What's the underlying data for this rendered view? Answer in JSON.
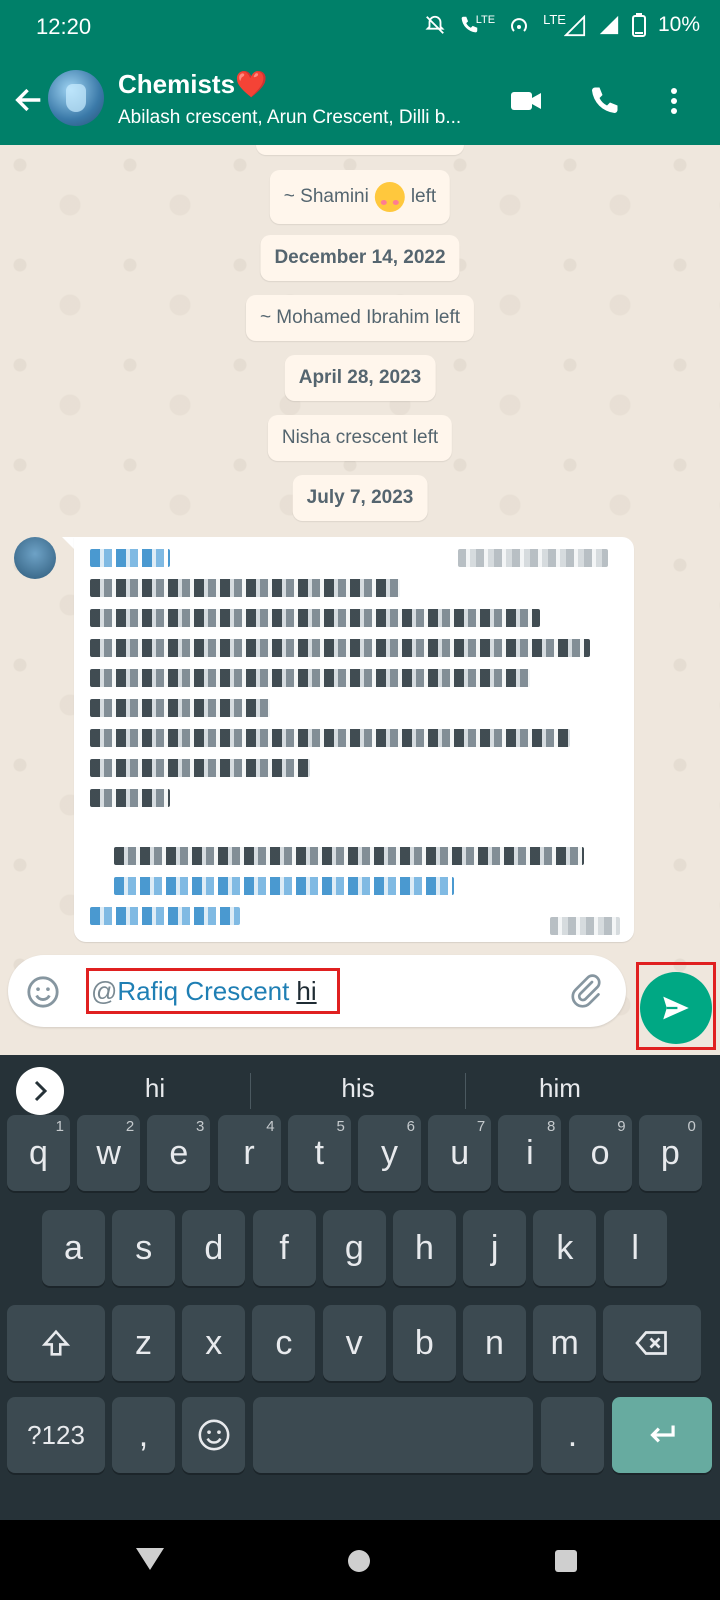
{
  "status_bar": {
    "time": "12:20",
    "lte1": "LTE",
    "lte2": "LTE",
    "battery": "10%"
  },
  "header": {
    "title": "Chemists❤️",
    "subtitle": "Abilash crescent, Arun Crescent, Dilli b..."
  },
  "messages": {
    "system": [
      {
        "text": "~ Shamini",
        "suffix": "left",
        "has_emoji": true
      },
      {
        "text": "December 14, 2022",
        "is_date": true
      },
      {
        "text": "~ Mohamed Ibrahim left"
      },
      {
        "text": "April 28, 2023",
        "is_date": true
      },
      {
        "text": "Nisha crescent left"
      },
      {
        "text": "July 7, 2023",
        "is_date": true
      }
    ]
  },
  "composer": {
    "mention_at": "@",
    "mention_name": "Rafiq Crescent",
    "typed": "hi"
  },
  "keyboard": {
    "suggestions": [
      "hi",
      "his",
      "him"
    ],
    "row1": [
      {
        "k": "q",
        "h": "1"
      },
      {
        "k": "w",
        "h": "2"
      },
      {
        "k": "e",
        "h": "3"
      },
      {
        "k": "r",
        "h": "4"
      },
      {
        "k": "t",
        "h": "5"
      },
      {
        "k": "y",
        "h": "6"
      },
      {
        "k": "u",
        "h": "7"
      },
      {
        "k": "i",
        "h": "8"
      },
      {
        "k": "o",
        "h": "9"
      },
      {
        "k": "p",
        "h": "0"
      }
    ],
    "row2": [
      "a",
      "s",
      "d",
      "f",
      "g",
      "h",
      "j",
      "k",
      "l"
    ],
    "row3": [
      "z",
      "x",
      "c",
      "v",
      "b",
      "n",
      "m"
    ],
    "symbols_label": "?123",
    "comma": ",",
    "period": "."
  },
  "colors": {
    "primary": "#008069",
    "send": "#00a884",
    "highlight": "#e02020"
  }
}
